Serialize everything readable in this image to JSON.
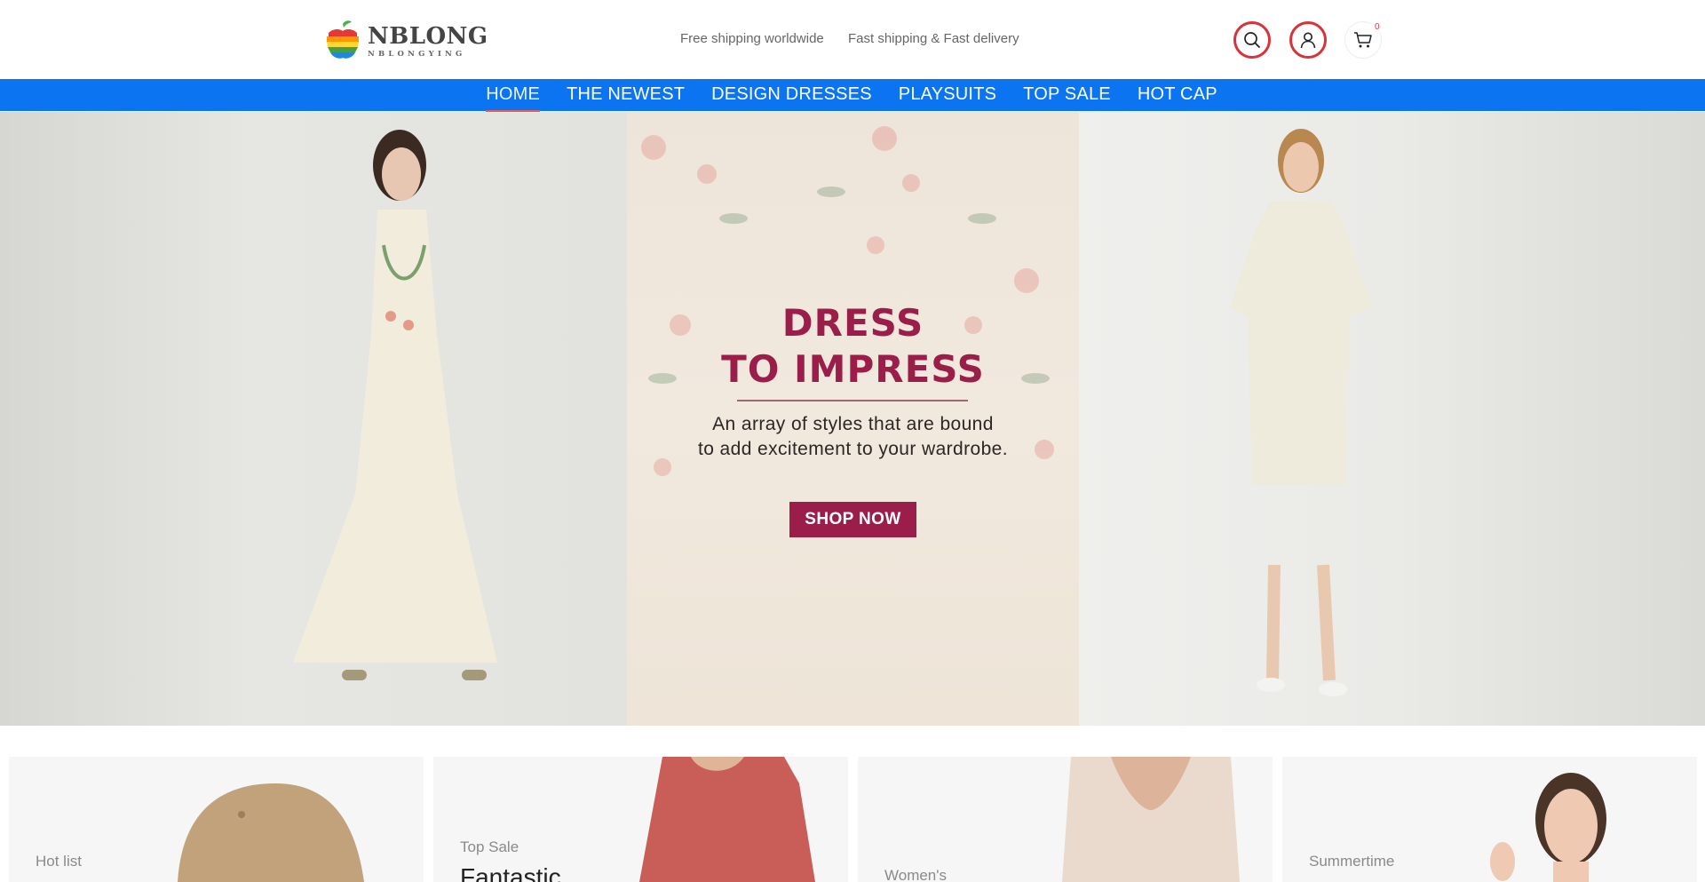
{
  "header": {
    "logo": {
      "name": "NBLONG",
      "tagline": "NBLONGYING"
    },
    "promos": [
      "Free shipping worldwide",
      "Fast shipping & Fast delivery"
    ],
    "icons": {
      "search": "search-icon",
      "account": "user-icon",
      "cart": "cart-icon"
    },
    "cart_count": "0",
    "colors": {
      "icon_ring": "#d73339"
    }
  },
  "nav": {
    "color": "#0b74f0",
    "items": [
      {
        "label": "HOME",
        "active": true
      },
      {
        "label": "THE NEWEST"
      },
      {
        "label": "DESIGN DRESSES"
      },
      {
        "label": "PLAYSUITS"
      },
      {
        "label": "TOP SALE"
      },
      {
        "label": "HOT CAP"
      }
    ]
  },
  "hero": {
    "title_line1": "DRESS",
    "title_line2": "TO IMPRESS",
    "subtitle_line1": "An array of styles that are bound",
    "subtitle_line2": "to add excitement to your wardrobe.",
    "cta": "SHOP NOW",
    "accent": "#9a1e49"
  },
  "cards": [
    {
      "label": "Hot list",
      "title": ""
    },
    {
      "label": "Top Sale",
      "title": "Fantastic"
    },
    {
      "label": "Women's",
      "title": ""
    },
    {
      "label": "Summertime",
      "title": ""
    }
  ]
}
